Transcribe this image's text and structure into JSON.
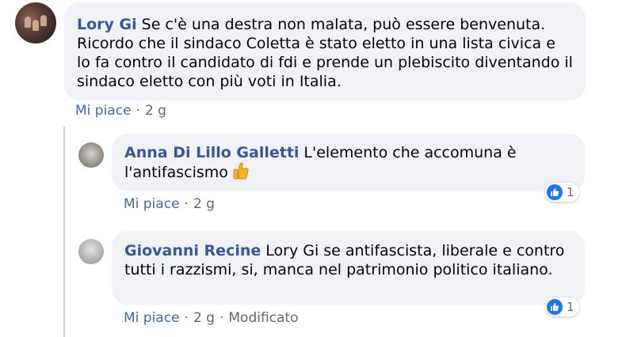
{
  "comments": [
    {
      "author": "Lory Gi",
      "text": "Se c'è una destra non malata, può essere benvenuta. Ricordo che il sindaco Coletta è stato eletto in una lista civica e lo fa contro il candidato di fdi e prende un plebiscito diventando il sindaco eletto con più voti in Italia.",
      "like_label": "Mi piace",
      "separator": "·",
      "age": "2 g"
    }
  ],
  "replies": [
    {
      "author": "Anna Di Lillo Galletti",
      "text": "L'elemento che accomuna è l'antifascismo",
      "emoji_icon": "thumbs-up-emoji",
      "like_label": "Mi piace",
      "separator": "·",
      "age": "2 g",
      "reaction_count": "1",
      "reaction_icon": "like-icon"
    },
    {
      "author": "Giovanni Recine",
      "text": "Lory Gi se antifascista, liberale e contro tutti i razzismi, si, manca nel patrimonio politico italiano.",
      "like_label": "Mi piace",
      "separator": "·",
      "age": "2 g",
      "edited_label": "Modificato",
      "reaction_count": "1",
      "reaction_icon": "like-icon"
    }
  ],
  "colors": {
    "author_name": "#385898",
    "like_link": "#4267b2",
    "bubble_bg": "#f0f2f5",
    "meta_text": "#65676b",
    "reaction_like": "#1877f2"
  }
}
